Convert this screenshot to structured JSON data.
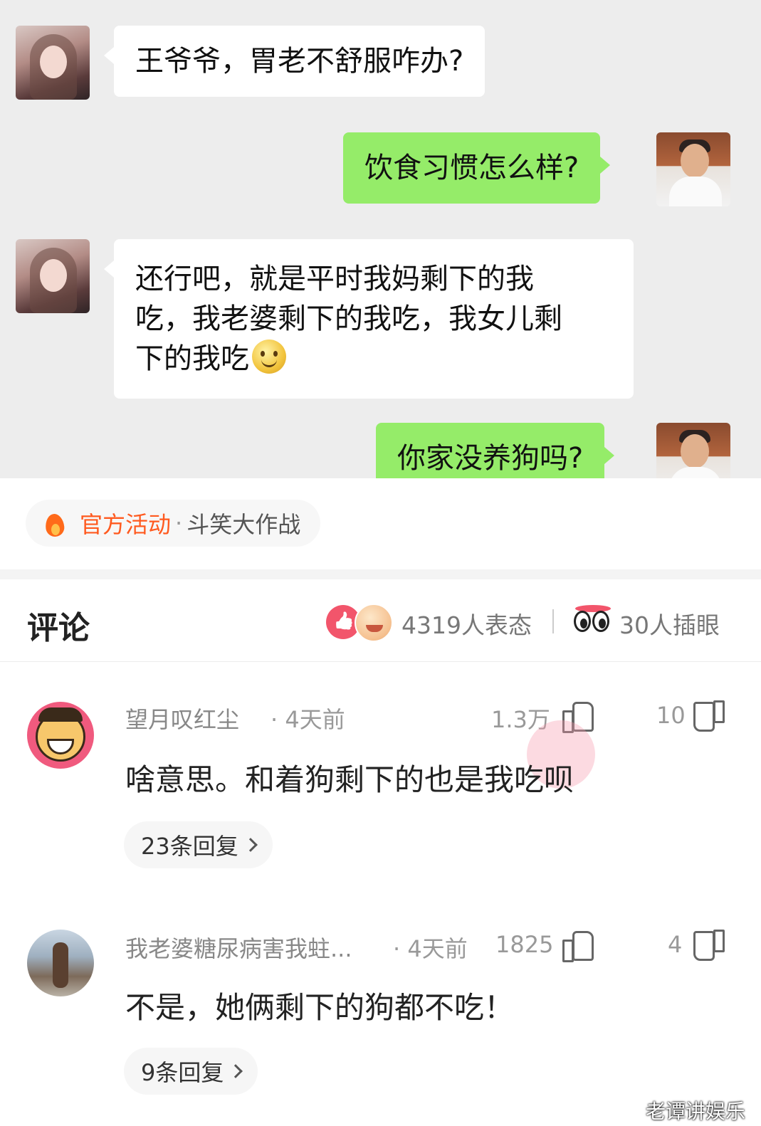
{
  "chat": {
    "messages": [
      {
        "side": "left",
        "text": "王爷爷，胃老不舒服咋办?"
      },
      {
        "side": "right",
        "text": "饮食习惯怎么样?"
      },
      {
        "side": "left",
        "lines": [
          "还行吧，就是平时我妈剩下的我",
          "吃，我老婆剩下的我吃，我女儿剩",
          "下的我吃"
        ],
        "emoji": "smile-emoji-icon"
      },
      {
        "side": "right",
        "text": "你家没养狗吗?"
      }
    ]
  },
  "activity": {
    "icon": "fire-icon",
    "main": "官方活动",
    "dot": "·",
    "sub": "斗笑大作战"
  },
  "comments_header": {
    "title": "评论",
    "reaction_count": "4319人表态",
    "poke_count": "30人插眼"
  },
  "comments": [
    {
      "user": "望月叹红尘",
      "time": "· 4天前",
      "likes": "1.3万",
      "dislikes": "10",
      "text": "啥意思。和着狗剩下的也是我吃呗",
      "replies": "23条回复"
    },
    {
      "user": "我老婆糖尿病害我蛀...",
      "time": "· 4天前",
      "likes": "1825",
      "dislikes": "4",
      "text": "不是，她俩剩下的狗都不吃！",
      "replies": "9条回复"
    }
  ],
  "watermark": "老谭讲娱乐",
  "colors": {
    "chat_bg": "#ededed",
    "bubble_green": "#95ec69",
    "accent_orange": "#ff5a1f",
    "like_pink": "#f2556b"
  }
}
